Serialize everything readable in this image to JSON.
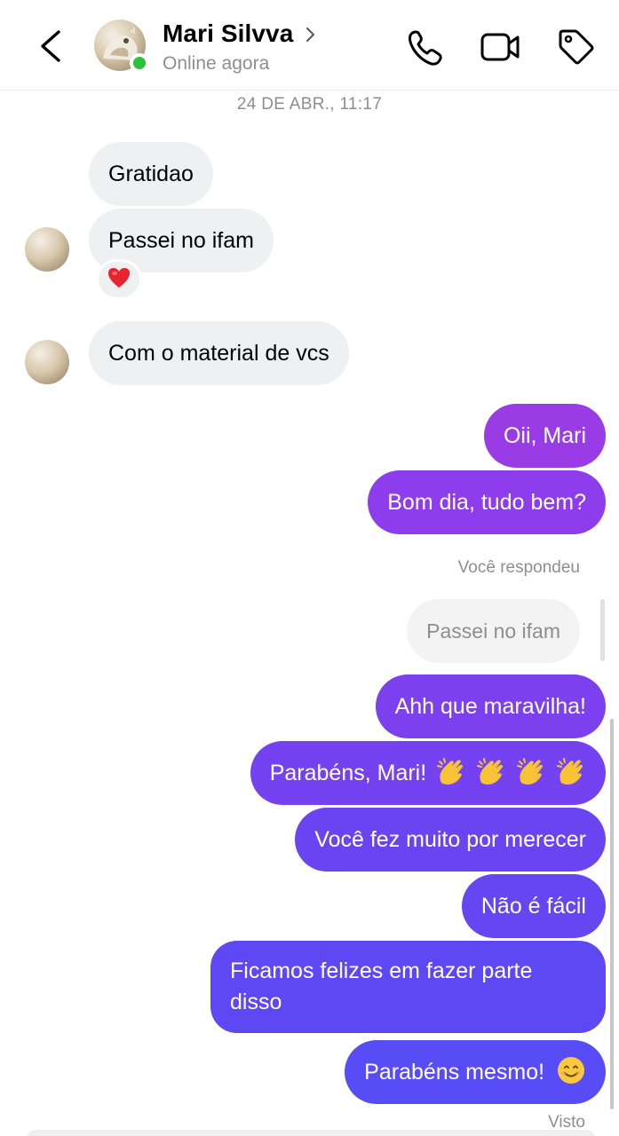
{
  "header": {
    "contact_name": "Mari Silvva",
    "status": "Online agora",
    "online_color": "#2bc23b",
    "icons": [
      "back-icon",
      "chevron-right-icon",
      "phone-icon",
      "video-icon",
      "tag-icon"
    ]
  },
  "conversation": {
    "timestamp": "24 DE ABR., 11:17",
    "incoming": [
      {
        "text": "Gratidao"
      },
      {
        "text": "Passei no ifam",
        "reaction": "heart"
      },
      {
        "text": "Com o material de vcs"
      }
    ],
    "outgoing": [
      {
        "text": "Oii, Mari"
      },
      {
        "text": "Bom dia, tudo bem?"
      }
    ],
    "reply": {
      "label": "Você respondeu",
      "quoted_text": "Passei no ifam"
    },
    "outgoing_after_reply": [
      {
        "text": "Ahh que maravilha!"
      },
      {
        "text": "Parabéns, Mari!",
        "emoji": "clapping-hands x4"
      },
      {
        "text": "Você fez muito por merecer"
      },
      {
        "text": "Não é fácil"
      },
      {
        "text": "Ficamos felizes em fazer parte disso"
      },
      {
        "text": "Parabéns mesmo!",
        "emoji": "smiling-face"
      }
    ],
    "seen_label": "Visto"
  },
  "colors": {
    "gradient_top": "#9b3be6",
    "gradient_mid": "#6c3ff2",
    "gradient_bottom": "#5a4cf6",
    "incoming_bubble": "#eff0f2",
    "meta_text": "#8e8e8e"
  }
}
